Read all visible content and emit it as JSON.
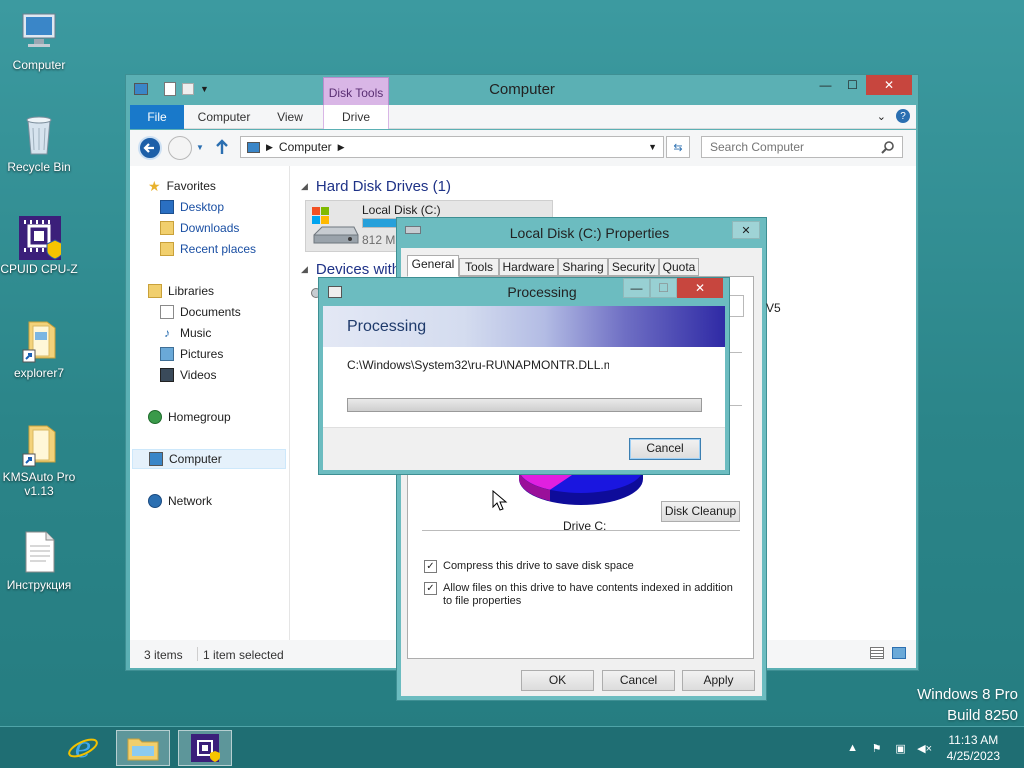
{
  "desktop": {
    "icons": [
      {
        "label": "Computer"
      },
      {
        "label": "Recycle Bin"
      },
      {
        "label": "CPUID CPU-Z"
      },
      {
        "label": "explorer7"
      },
      {
        "label": "KMSAuto Pro\nv1.13"
      },
      {
        "label": "Инструкция"
      }
    ],
    "watermark": {
      "line1": "Windows 8 Pro",
      "line2": "Build 8250"
    }
  },
  "taskbar": {
    "clock": {
      "time": "11:13 AM",
      "date": "4/25/2023"
    },
    "apps": [
      "internet-explorer",
      "file-explorer",
      "cpu-z"
    ]
  },
  "explorer": {
    "title": "Computer",
    "context_tab": "Disk Tools",
    "ribbon_tabs": {
      "file": "File",
      "computer": "Computer",
      "view": "View",
      "drive": "Drive"
    },
    "address": "Computer",
    "search_placeholder": "Search Computer",
    "nav": {
      "favorites": "Favorites",
      "desktop": "Desktop",
      "downloads": "Downloads",
      "recent": "Recent places",
      "libraries": "Libraries",
      "documents": "Documents",
      "music": "Music",
      "pictures": "Pictures",
      "videos": "Videos",
      "homegroup": "Homegroup",
      "computer": "Computer",
      "network": "Network"
    },
    "groups": {
      "hdd": "Hard Disk Drives (1)",
      "devices": "Devices with"
    },
    "drive": {
      "name": "Local Disk (C:)",
      "free": "812 MI"
    },
    "status": {
      "items": "3 items",
      "selected": "1 item selected"
    }
  },
  "properties": {
    "title": "Local Disk (C:) Properties",
    "tabs": [
      "General",
      "Tools",
      "Hardware",
      "Sharing",
      "Security",
      "Quota"
    ],
    "fs_partial": "V5",
    "chart_label": "Drive C:",
    "disk_cleanup": "Disk Cleanup",
    "compress": "Compress this drive to save disk space",
    "index": "Allow files on this drive to have contents indexed in addition to file properties",
    "buttons": {
      "ok": "OK",
      "cancel": "Cancel",
      "apply": "Apply"
    },
    "colors": {
      "used": "#1a16e0",
      "free": "#e020e0"
    }
  },
  "processing": {
    "title": "Processing",
    "heading": "Processing",
    "path": "C:\\Windows\\System32\\ru-RU\\NAPMONTR.DLL.m",
    "progress": 0,
    "cancel": "Cancel"
  }
}
